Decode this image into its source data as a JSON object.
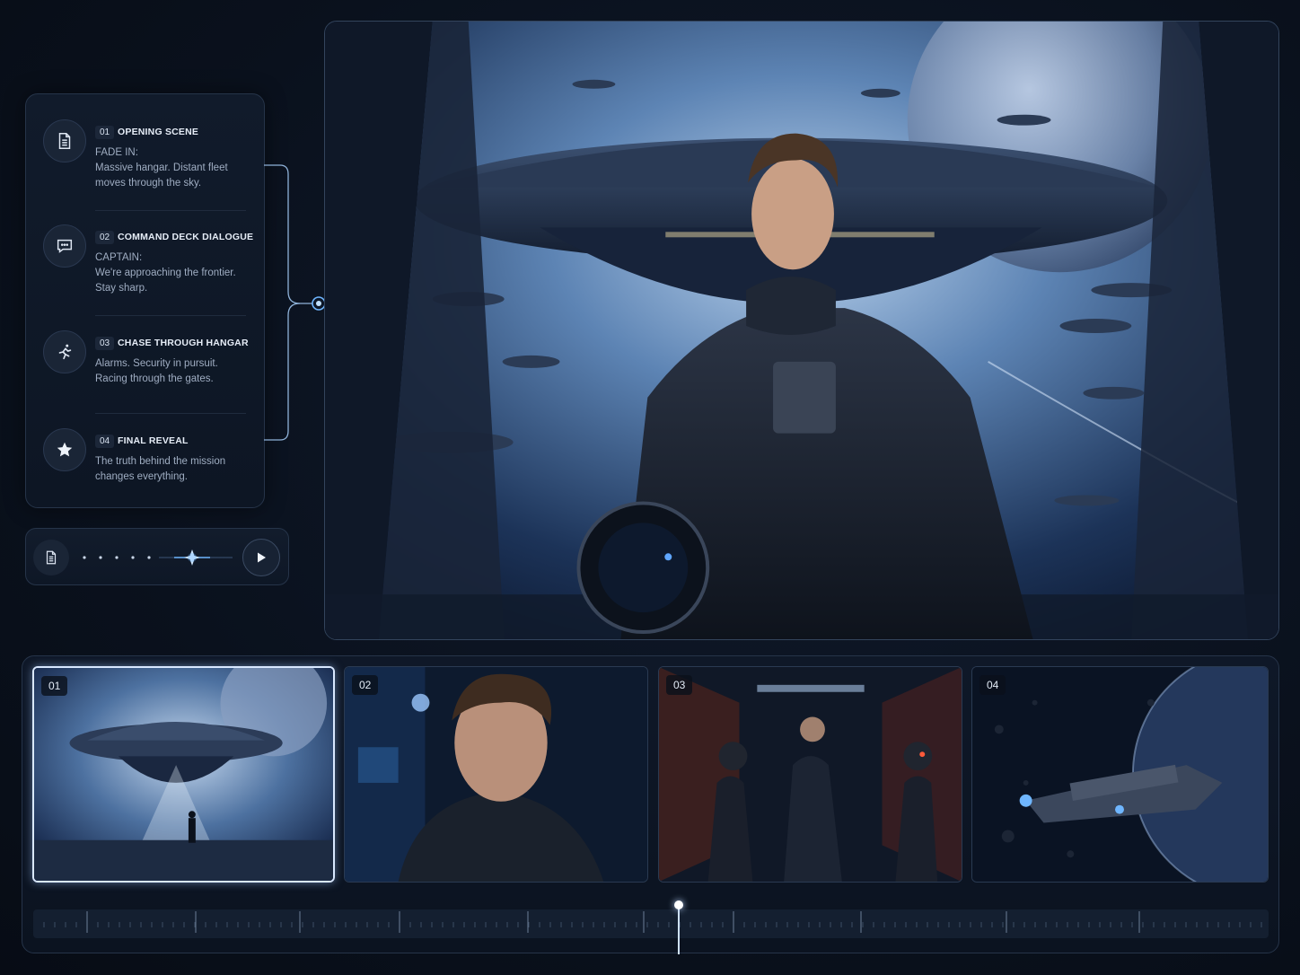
{
  "scenes": [
    {
      "num": "01",
      "title": "OPENING SCENE",
      "lines": [
        "FADE IN:",
        "Massive hangar. Distant fleet",
        "moves through the sky."
      ],
      "icon": "document-icon"
    },
    {
      "num": "02",
      "title": "COMMAND DECK DIALOGUE",
      "lines": [
        "CAPTAIN:",
        "We're approaching the frontier.",
        "Stay sharp."
      ],
      "icon": "chat-icon"
    },
    {
      "num": "03",
      "title": "CHASE THROUGH HANGAR",
      "lines": [
        "Alarms. Security in pursuit.",
        "Racing through the gates."
      ],
      "icon": "running-icon"
    },
    {
      "num": "04",
      "title": "FINAL REVEAL",
      "lines": [
        "The truth behind the mission",
        "changes everything."
      ],
      "icon": "star-icon"
    }
  ],
  "player": {
    "doc_icon": "document-icon",
    "play_icon": "play-icon",
    "progress": 0.5
  },
  "storyboard": {
    "frames": [
      {
        "label": "01",
        "active": true
      },
      {
        "label": "02",
        "active": false
      },
      {
        "label": "03",
        "active": false
      },
      {
        "label": "04",
        "active": false
      }
    ],
    "playhead_position": 0.52
  },
  "colors": {
    "accent": "#5aa8ff",
    "background": "#0b1220",
    "panel_border": "#263449"
  }
}
